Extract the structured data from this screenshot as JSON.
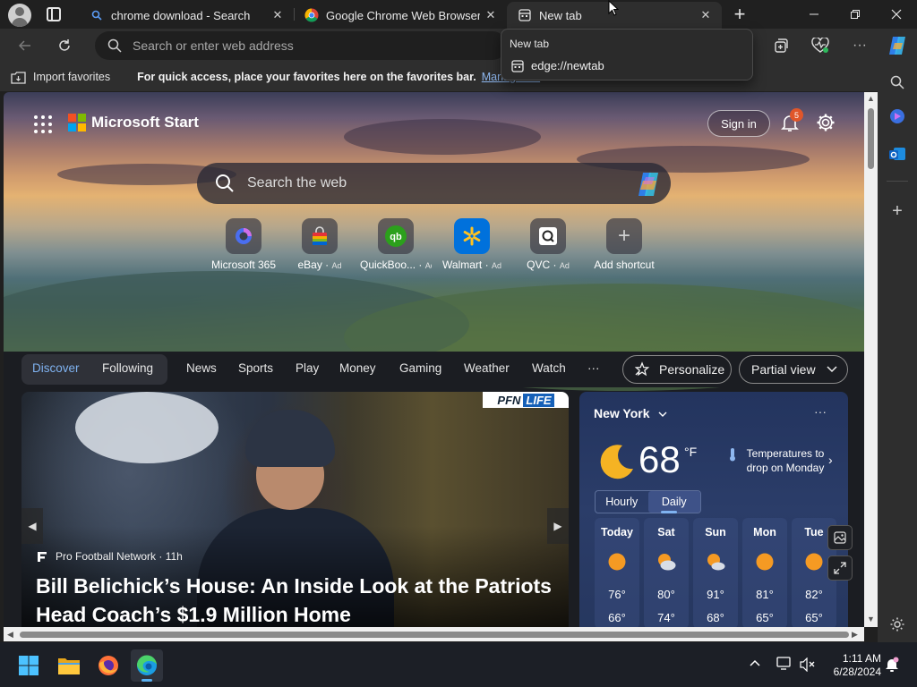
{
  "browser": {
    "tabs": [
      {
        "title": "chrome download - Search"
      },
      {
        "title": "Google Chrome Web Browser"
      },
      {
        "title": "New tab"
      }
    ],
    "address": {
      "placeholder": "Search or enter web address"
    },
    "dropdown": {
      "title": "New tab",
      "url": "edge://newtab"
    },
    "favorites_bar": {
      "import_label": "Import favorites",
      "message": "For quick access, place your favorites here on the favorites bar.",
      "manage_link": "Manage fav"
    }
  },
  "page": {
    "brand": "Microsoft Start",
    "sign_in": "Sign in",
    "notification_count": "5",
    "search_placeholder": "Search the web",
    "shortcuts": [
      {
        "label": "Microsoft 365",
        "ad": ""
      },
      {
        "label": "eBay",
        "ad": "Ad"
      },
      {
        "label": "QuickBoo...",
        "ad": "Ad"
      },
      {
        "label": "Walmart",
        "ad": "Ad"
      },
      {
        "label": "QVC",
        "ad": "Ad"
      },
      {
        "label": "Add shortcut",
        "ad": ""
      }
    ],
    "nav": {
      "discover": "Discover",
      "following": "Following",
      "items": [
        "News",
        "Sports",
        "Play",
        "Money",
        "Gaming",
        "Weather",
        "Watch"
      ],
      "more": "···",
      "personalize": "Personalize",
      "view": "Partial view"
    },
    "news": {
      "badge_left": "PFN",
      "badge_right": "LIFE",
      "source": "Pro Football Network · 11h",
      "headline": "Bill Belichick’s House: An Inside Look at the Patriots Head Coach’s $1.9 Million Home"
    },
    "weather": {
      "city": "New York",
      "more": "···",
      "temp": "68",
      "unit": "°F",
      "alert": "Temperatures to drop on Monday",
      "tabs": {
        "hourly": "Hourly",
        "daily": "Daily"
      },
      "days": [
        {
          "name": "Today",
          "hi": "76°",
          "lo": "66°",
          "icon": "sun-icon"
        },
        {
          "name": "Sat",
          "hi": "80°",
          "lo": "74°",
          "icon": "partly-cloudy-icon"
        },
        {
          "name": "Sun",
          "hi": "91°",
          "lo": "68°",
          "icon": "partly-cloudy-icon"
        },
        {
          "name": "Mon",
          "hi": "81°",
          "lo": "65°",
          "icon": "sun-icon"
        },
        {
          "name": "Tue",
          "hi": "82°",
          "lo": "65°",
          "icon": "sun-icon"
        }
      ]
    }
  },
  "taskbar": {
    "time": "1:11 AM",
    "date": "6/28/2024"
  },
  "colors": {
    "accent_blue": "#7fb2f0",
    "titlebar": "#202020",
    "toolbar": "#2e2e2e",
    "weather_card": "#2b3d69",
    "notification_badge": "#e0562a"
  }
}
